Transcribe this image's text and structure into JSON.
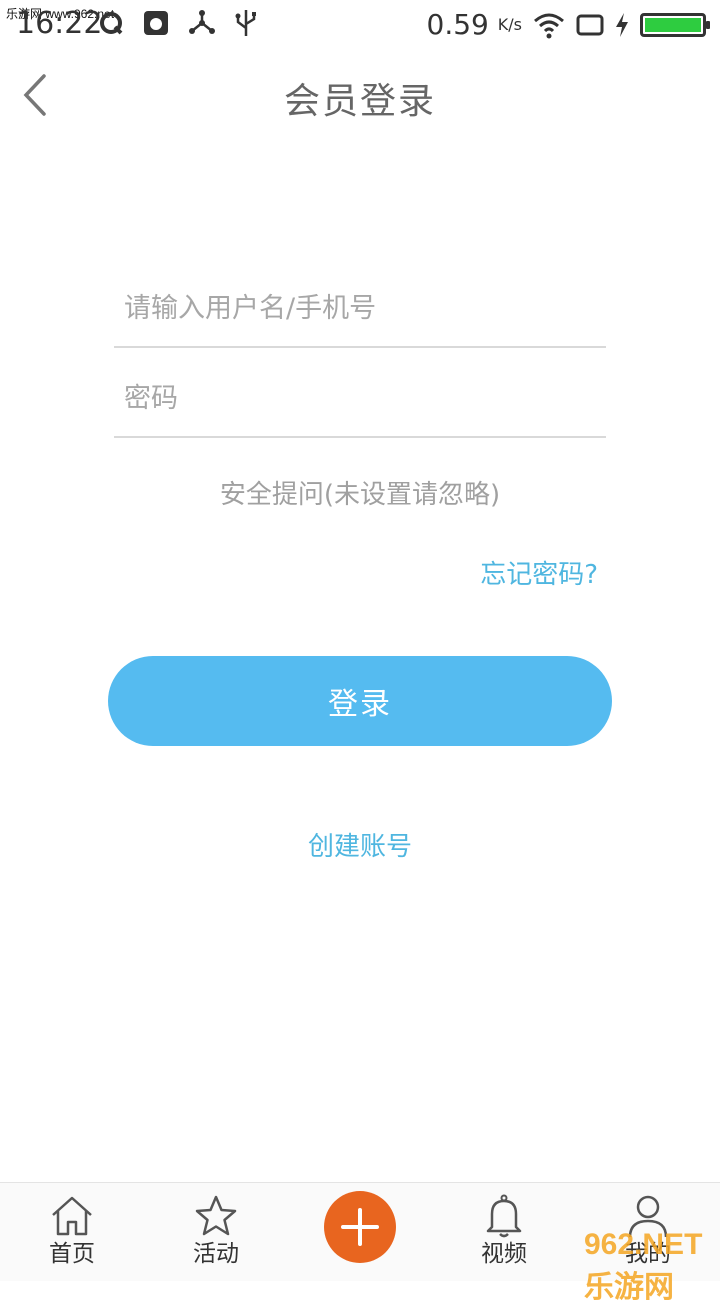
{
  "status_bar": {
    "time": "16:22",
    "watermark": "乐游网 www.962.net",
    "speed": "0.59",
    "speed_unit": "K/s"
  },
  "header": {
    "title": "会员登录"
  },
  "form": {
    "username_placeholder": "请输入用户名/手机号",
    "password_placeholder": "密码",
    "security_question": "安全提问(未设置请忽略)",
    "forgot_password": "忘记密码?",
    "login_button": "登录",
    "create_account": "创建账号"
  },
  "bottom_nav": {
    "items": [
      {
        "label": "首页",
        "icon": "home-icon"
      },
      {
        "label": "活动",
        "icon": "star-icon"
      },
      {
        "label": "",
        "icon": "plus-icon"
      },
      {
        "label": "视频",
        "icon": "bell-icon"
      },
      {
        "label": "我的",
        "icon": "user-icon"
      }
    ]
  },
  "watermark_bottom": "962.NET 乐游网",
  "colors": {
    "accent_blue": "#55bbf0",
    "link_blue": "#4fb6e0",
    "plus_orange": "#e8651f",
    "battery_green": "#2ecc40"
  }
}
